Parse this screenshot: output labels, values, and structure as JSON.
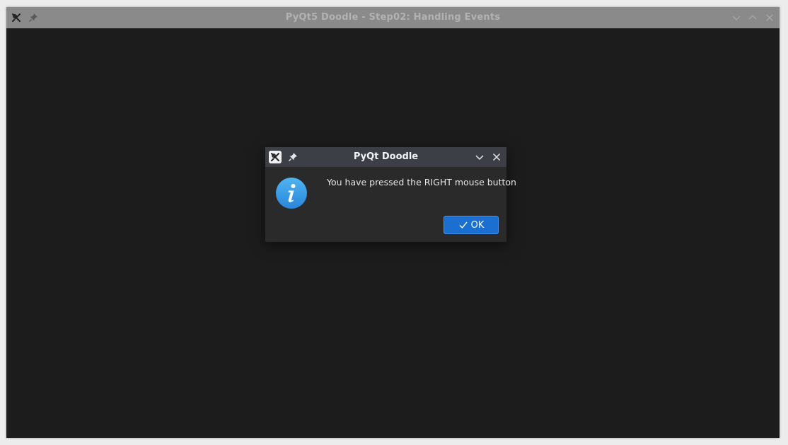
{
  "main_window": {
    "title": "PyQt5 Doodle - Step02: Handling Events",
    "icons": {
      "app": "kde-app-icon",
      "pin": "pin-icon",
      "minimize": "chevron-down-icon",
      "maximize": "chevron-up-icon",
      "close": "close-icon"
    }
  },
  "dialog": {
    "title": "PyQt Doodle",
    "message": "You have pressed the RIGHT mouse button",
    "ok_label": "OK",
    "icons": {
      "app": "kde-app-icon",
      "pin": "pin-icon",
      "collapse": "chevron-down-icon",
      "close": "close-icon",
      "info": "information-icon",
      "check": "check-icon"
    }
  },
  "colors": {
    "main_titlebar": "#8a8a8a",
    "main_background": "#1c1c1c",
    "dialog_titlebar": "#3c4046",
    "dialog_background": "#2a2a2a",
    "ok_button": "#1a6fd0",
    "info_icon": "#3aa0e8"
  }
}
